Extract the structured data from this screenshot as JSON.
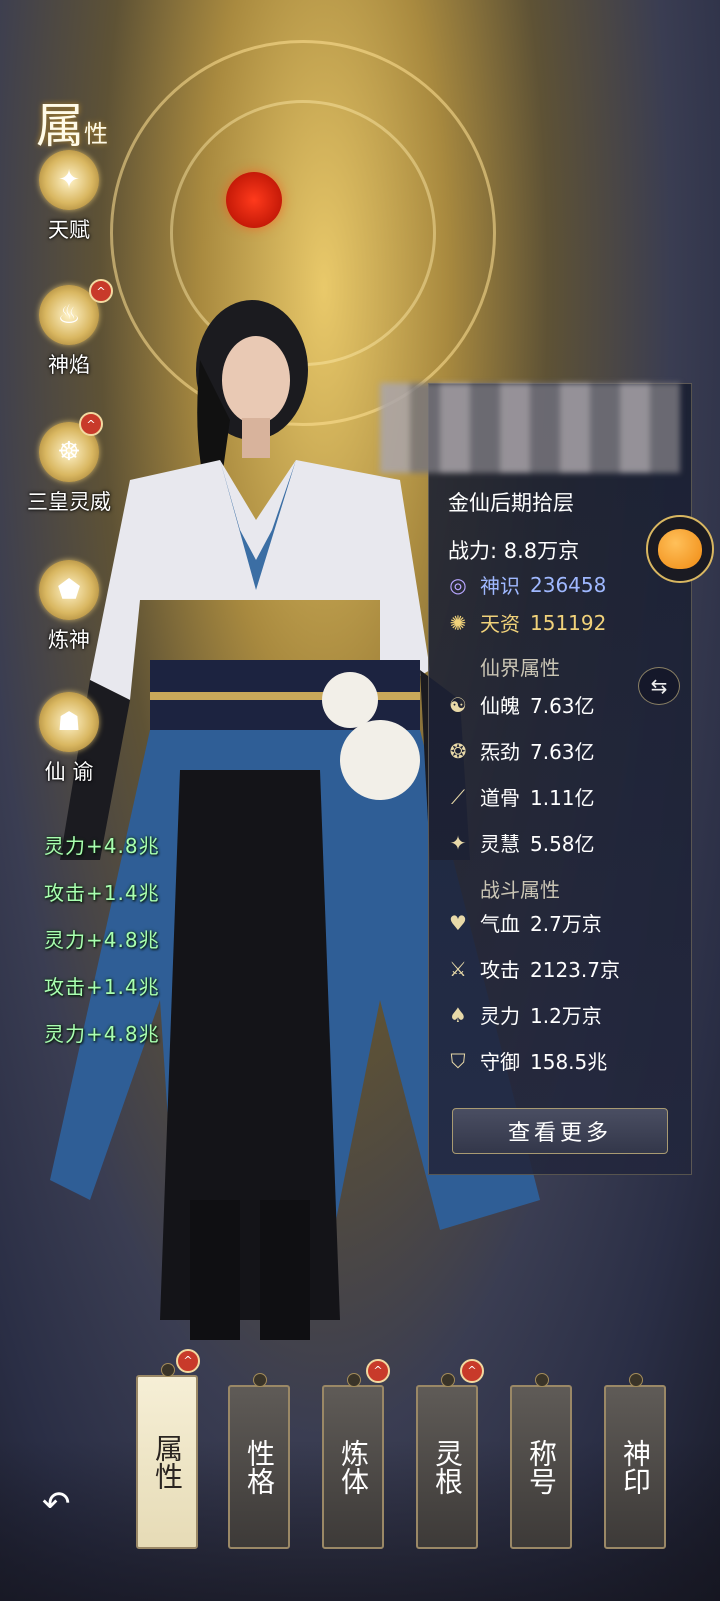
{
  "title": {
    "big": "属",
    "small": "性"
  },
  "left_menu": [
    {
      "label": "天赋",
      "icon": "star-orb-icon",
      "badge": false
    },
    {
      "label": "神焰",
      "icon": "flame-icon",
      "badge": true
    },
    {
      "label": "三皇灵威",
      "icon": "sage-orb-icon",
      "badge": true
    },
    {
      "label": "炼神",
      "icon": "meditation-pentagon-icon",
      "badge": false
    },
    {
      "label": "仙  谕",
      "icon": "immortal-statue-icon",
      "badge": false
    }
  ],
  "buffs": [
    "灵力+4.8兆",
    "攻击+1.4兆",
    "灵力+4.8兆",
    "攻击+1.4兆",
    "灵力+4.8兆"
  ],
  "panel": {
    "realm": "金仙后期拾层",
    "power": "战力: 8.8万京",
    "shenshi": {
      "label": "神识",
      "value": "236458",
      "color": "#9fb8ff"
    },
    "tianzi": {
      "label": "天资",
      "value": "151192",
      "color": "#f1d27a"
    },
    "immortal_section": "仙界属性",
    "immortal_stats": [
      {
        "icon": "meditate-icon",
        "label": "仙魄",
        "value": "7.63亿"
      },
      {
        "icon": "fire-swirl-icon",
        "label": "炁劲",
        "value": "7.63亿"
      },
      {
        "icon": "bone-icon",
        "label": "道骨",
        "value": "1.11亿"
      },
      {
        "icon": "sparkle-icon",
        "label": "灵慧",
        "value": "5.58亿"
      }
    ],
    "battle_section": "战斗属性",
    "battle_stats": [
      {
        "icon": "heart-icon",
        "label": "气血",
        "value": "2.7万京"
      },
      {
        "icon": "crossed-swords-icon",
        "label": "攻击",
        "value": "2123.7京"
      },
      {
        "icon": "spirit-flame-icon",
        "label": "灵力",
        "value": "1.2万京"
      },
      {
        "icon": "shield-icon",
        "label": "守御",
        "value": "158.5兆"
      }
    ],
    "more_button": "查看更多"
  },
  "tabs": [
    {
      "label": "属性",
      "active": true,
      "badge": true
    },
    {
      "label": "性格",
      "active": false,
      "badge": false
    },
    {
      "label": "炼体",
      "active": false,
      "badge": true
    },
    {
      "label": "灵根",
      "active": false,
      "badge": true
    },
    {
      "label": "称号",
      "active": false,
      "badge": false
    },
    {
      "label": "神印",
      "active": false,
      "badge": false
    }
  ],
  "colors": {
    "gold": "#d9b761",
    "buff_green": "#a9ffb0",
    "badge_red": "#c83a2a"
  }
}
